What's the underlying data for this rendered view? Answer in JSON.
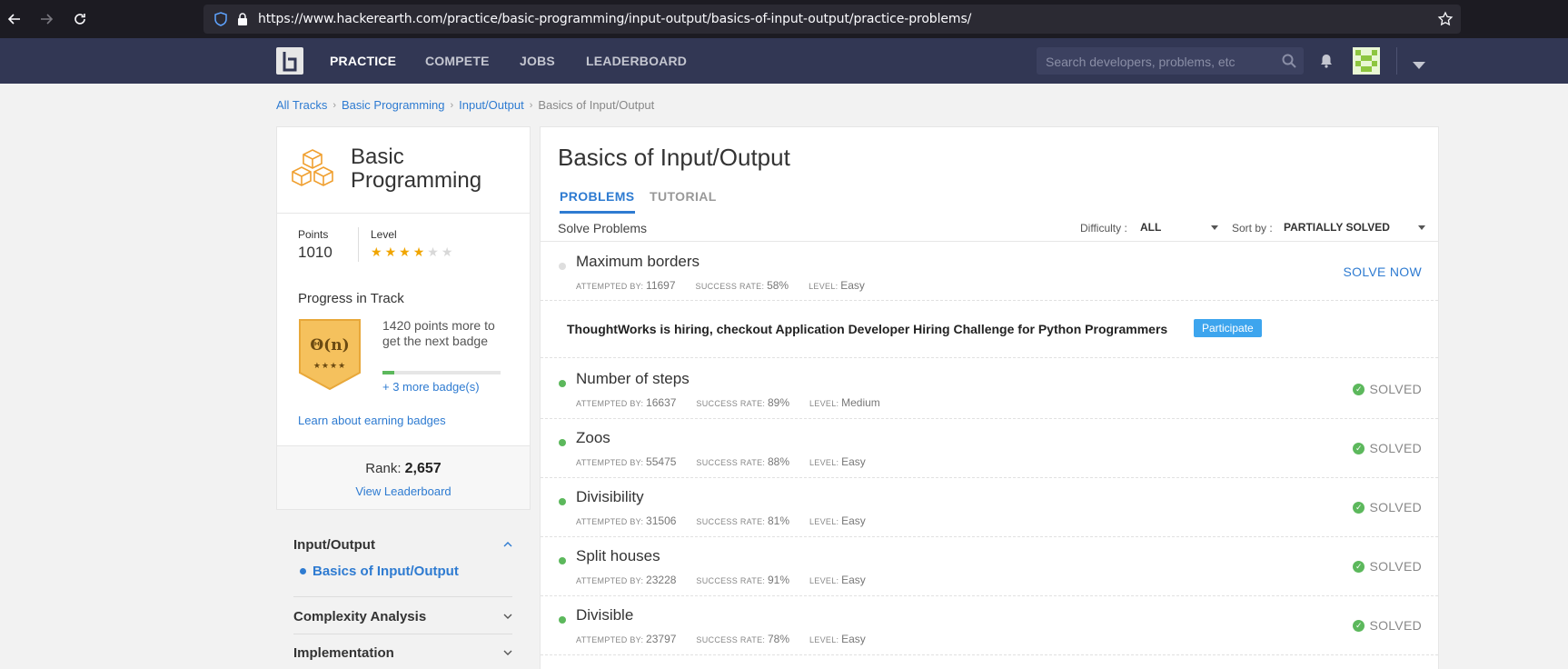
{
  "browser": {
    "url": "https://www.hackerearth.com/practice/basic-programming/input-output/basics-of-input-output/practice-problems/"
  },
  "header": {
    "nav": [
      "PRACTICE",
      "COMPETE",
      "JOBS",
      "LEADERBOARD"
    ],
    "search_placeholder": "Search developers, problems, etc"
  },
  "breadcrumb": [
    "All Tracks",
    "Basic Programming",
    "Input/Output",
    "Basics of Input/Output"
  ],
  "track": {
    "title": "Basic Programming",
    "points_label": "Points",
    "points_value": "1010",
    "level_label": "Level",
    "level_stars": 4,
    "level_max": 6,
    "progress_title": "Progress in Track",
    "badge_symbol": "Θ(n)",
    "badge_stars": "★★★★",
    "badge_text": "1420 points more to get the next badge",
    "badge_progress": 0.1,
    "more_badges": "+ 3 more badge(s)",
    "learn_link": "Learn about earning badges",
    "rank_label": "Rank:",
    "rank_value": "2,657",
    "leaderboard_link": "View Leaderboard"
  },
  "sections": {
    "input_output": "Input/Output",
    "basics": "Basics of Input/Output",
    "complexity": "Complexity Analysis",
    "implementation": "Implementation"
  },
  "main": {
    "title": "Basics of Input/Output",
    "tabs": [
      "PROBLEMS",
      "TUTORIAL"
    ],
    "solve_problems": "Solve Problems",
    "difficulty_label": "Difficulty :",
    "difficulty_value": "ALL",
    "sort_label": "Sort by :",
    "sort_value": "PARTIALLY SOLVED",
    "attempted_label": "ATTEMPTED BY:",
    "success_label": "SUCCESS RATE:",
    "level_label": "LEVEL:",
    "solve_now": "SOLVE NOW",
    "solved": "SOLVED",
    "promo_text": "ThoughtWorks is hiring, checkout Application Developer Hiring Challenge for Python Programmers",
    "participate": "Participate",
    "problems": [
      {
        "name": "Maximum borders",
        "attempted": "11697",
        "rate": "58%",
        "level": "Easy",
        "status": "unsolved"
      },
      {
        "name": "Number of steps",
        "attempted": "16637",
        "rate": "89%",
        "level": "Medium",
        "status": "solved"
      },
      {
        "name": "Zoos",
        "attempted": "55475",
        "rate": "88%",
        "level": "Easy",
        "status": "solved"
      },
      {
        "name": "Divisibility",
        "attempted": "31506",
        "rate": "81%",
        "level": "Easy",
        "status": "solved"
      },
      {
        "name": "Split houses",
        "attempted": "23228",
        "rate": "91%",
        "level": "Easy",
        "status": "solved"
      },
      {
        "name": "Divisible",
        "attempted": "23797",
        "rate": "78%",
        "level": "Easy",
        "status": "solved"
      }
    ]
  }
}
